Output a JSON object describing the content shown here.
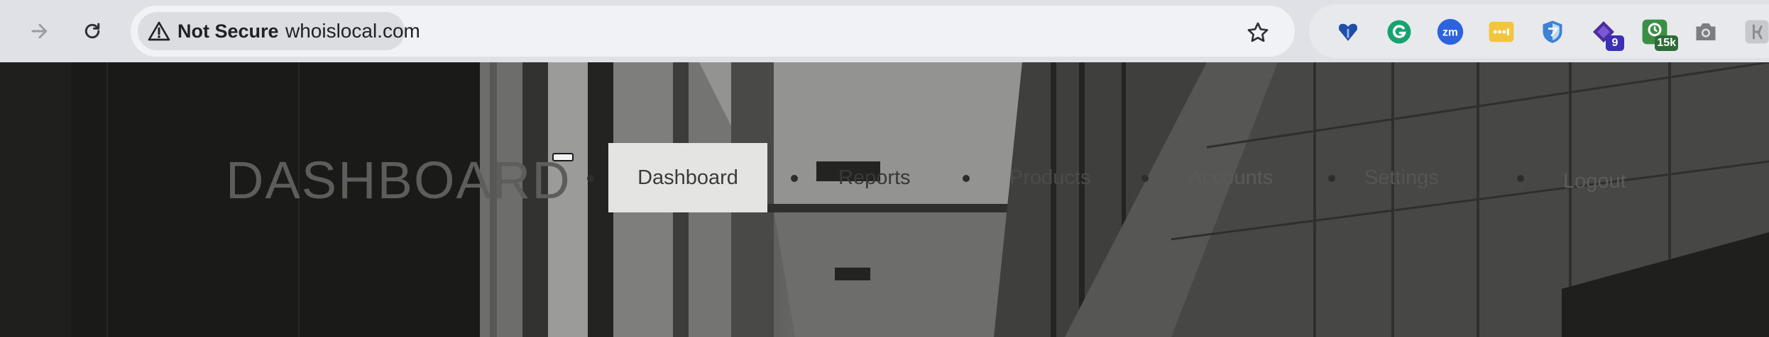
{
  "browser": {
    "security_label": "Not Secure",
    "url": "whoislocal.com",
    "extensions": [
      {
        "name": "heart-extension-icon",
        "badge": ""
      },
      {
        "name": "grammarly-extension-icon",
        "badge": ""
      },
      {
        "name": "zoom-extension-icon",
        "badge": ""
      },
      {
        "name": "password-extension-icon",
        "badge": ""
      },
      {
        "name": "shield-extension-icon",
        "badge": ""
      },
      {
        "name": "diamond-extension-icon",
        "badge": "9"
      },
      {
        "name": "green-extension-icon",
        "badge": "15k"
      },
      {
        "name": "camera-extension-icon",
        "badge": ""
      },
      {
        "name": "grey-extension-icon",
        "badge": ""
      }
    ]
  },
  "site": {
    "brand": "DASHBOARD",
    "nav": {
      "dashboard": "Dashboard",
      "reports": "Reports",
      "products": "Products",
      "accounts": "Accounts",
      "settings": "Settings",
      "logout": "Logout"
    }
  },
  "colors": {
    "toolbar": "#dfe1e6",
    "omnibox": "#f1f2f5",
    "active_nav_bg": "#e4e4e3"
  }
}
